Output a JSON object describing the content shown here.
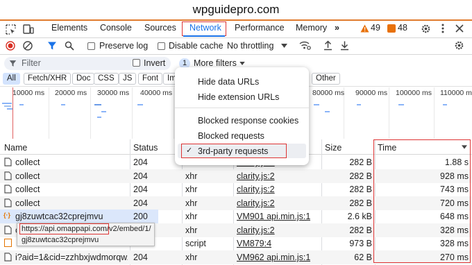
{
  "banner": {
    "site": "wpguidepro.com"
  },
  "tabs": [
    {
      "id": "elements",
      "label": "Elements"
    },
    {
      "id": "console",
      "label": "Console"
    },
    {
      "id": "sources",
      "label": "Sources"
    },
    {
      "id": "network",
      "label": "Network"
    },
    {
      "id": "performance",
      "label": "Performance"
    },
    {
      "id": "memory",
      "label": "Memory"
    }
  ],
  "counts": {
    "warnings": "49",
    "errors": "48"
  },
  "toolbar": {
    "preserve_log": "Preserve log",
    "disable_cache": "Disable cache",
    "throttling": "No throttling"
  },
  "filter": {
    "placeholder": "Filter",
    "invert": "Invert",
    "more_badge": "1",
    "more_filters": "More filters"
  },
  "type_chips": [
    "All",
    "Fetch/XHR",
    "Doc",
    "CSS",
    "JS",
    "Font",
    "Im",
    "Other"
  ],
  "overview": {
    "ticks": [
      "10000 ms",
      "20000 ms",
      "30000 ms",
      "40000 ms",
      "80000 ms",
      "90000 ms",
      "100000 ms",
      "110000 m"
    ]
  },
  "more_filters_menu": {
    "items": [
      {
        "label": "Hide data URLs",
        "checked": false
      },
      {
        "label": "Hide extension URLs",
        "checked": false
      },
      {
        "label": "Blocked response cookies",
        "checked": false
      },
      {
        "label": "Blocked requests",
        "checked": false
      },
      {
        "label": "3rd-party requests",
        "checked": true
      }
    ],
    "checkmark": "✓"
  },
  "table": {
    "headers": {
      "name": "Name",
      "status": "Status",
      "size": "Size",
      "time": "Time"
    },
    "rows": [
      {
        "name": "collect",
        "status": "204",
        "type": "xhr",
        "initiator": "clarity.js:2",
        "size": "282 B",
        "time": "1.88 s",
        "icon": "document-icon"
      },
      {
        "name": "collect",
        "status": "204",
        "type": "xhr",
        "initiator": "clarity.js:2",
        "size": "282 B",
        "time": "928 ms",
        "icon": "document-icon"
      },
      {
        "name": "collect",
        "status": "204",
        "type": "xhr",
        "initiator": "clarity.js:2",
        "size": "282 B",
        "time": "743 ms",
        "icon": "document-icon"
      },
      {
        "name": "collect",
        "status": "204",
        "type": "xhr",
        "initiator": "clarity.js:2",
        "size": "282 B",
        "time": "720 ms",
        "icon": "document-icon"
      },
      {
        "name": "gj8zuwtcac32cprejmvu",
        "status": "200",
        "type": "xhr",
        "initiator": "VM901 api.min.js:1",
        "size": "2.6 kB",
        "time": "648 ms",
        "icon": "json-icon"
      },
      {
        "name": "c",
        "status": "204",
        "type": "xhr",
        "initiator": "clarity.js:2",
        "size": "282 B",
        "time": "328 ms",
        "icon": "document-icon"
      },
      {
        "name": "",
        "status": "",
        "type": "script",
        "initiator": "VM879:4",
        "size": "973 B",
        "time": "328 ms",
        "icon": "script-icon"
      },
      {
        "name": "i?aid=1&cid=zzhbxjwdmorqw...",
        "status": "204",
        "type": "xhr",
        "initiator": "VM962 api.min.js:1",
        "size": "62 B",
        "time": "270 ms",
        "icon": "document-icon"
      }
    ]
  },
  "tooltip": {
    "url_prefix": "https://api.omappapi.com/",
    "url_rest": "v2/embed/1/",
    "line2": "gj8zuwtcac32cprejmvu"
  },
  "colors": {
    "accent": "#1a73e8",
    "highlight": "#d33333",
    "banner_line": "#e07b2e",
    "selected_row": "#dbe7fb"
  }
}
